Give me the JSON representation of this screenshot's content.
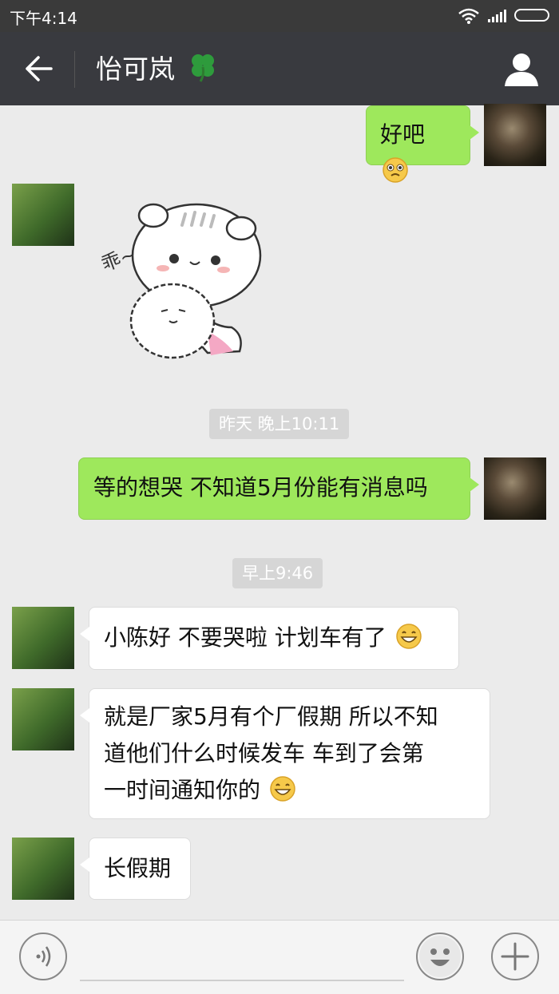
{
  "status_bar": {
    "time": "下午4:14"
  },
  "header": {
    "title": "怡可岚"
  },
  "messages": [
    {
      "side": "me",
      "text": "好吧"
    },
    {
      "side": "them",
      "type": "sticker",
      "sticker_text": "乖~"
    },
    {
      "type": "timestamp",
      "text": "昨天 晚上10:11"
    },
    {
      "side": "me",
      "text": "等的想哭 不知道5月份能有消息吗"
    },
    {
      "type": "timestamp",
      "text": "早上9:46"
    },
    {
      "side": "them",
      "text": "小陈好 不要哭啦 计划车有了"
    },
    {
      "side": "them",
      "lines": [
        "就是厂家5月有个厂假期 所以不知",
        "道他们什么时候发车 车到了会第",
        "一时间通知你的"
      ]
    },
    {
      "side": "them",
      "text": "长假期"
    }
  ],
  "icons": {
    "back": "arrow-left-icon",
    "contact": "person-icon",
    "voice": "voice-icon",
    "emoji": "smiley-icon",
    "more": "plus-icon"
  },
  "colors": {
    "navbar": "#393a3f",
    "my_bubble": "#9ee85c",
    "their_bubble": "#ffffff",
    "background": "#ebebeb"
  }
}
